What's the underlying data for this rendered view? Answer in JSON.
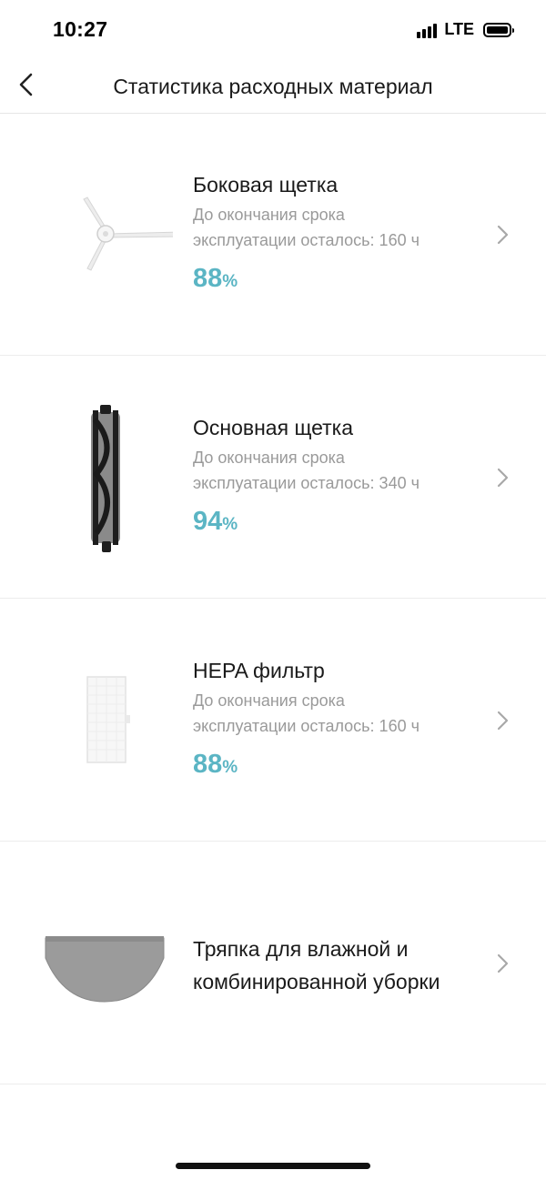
{
  "status": {
    "time": "10:27",
    "network": "LTE"
  },
  "header": {
    "title": "Статистика расходных материал"
  },
  "items": [
    {
      "title": "Боковая щетка",
      "subtitle_line1": "До окончания срока",
      "subtitle_line2": "эксплуатации осталось: 160 ч",
      "percent": "88",
      "unit": "%"
    },
    {
      "title": "Основная щетка",
      "subtitle_line1": "До окончания срока",
      "subtitle_line2": "эксплуатации осталось: 340 ч",
      "percent": "94",
      "unit": "%"
    },
    {
      "title": "HEPA фильтр",
      "subtitle_line1": "До окончания срока",
      "subtitle_line2": "эксплуатации осталось: 160 ч",
      "percent": "88",
      "unit": "%"
    },
    {
      "title_line1": "Тряпка для влажной и",
      "title_line2": "комбинированной уборки"
    }
  ],
  "colors": {
    "accent": "#5bb5c4",
    "subtitle": "#9a9a9a",
    "divider": "#ececec"
  },
  "icons": {
    "back": "chevron-left-icon",
    "row": "chevron-right-icon",
    "side_brush": "side-brush-image",
    "main_brush": "main-brush-image",
    "hepa": "hepa-filter-image",
    "mop": "mop-cloth-image",
    "signal": "signal-bars-icon",
    "battery": "battery-icon"
  }
}
